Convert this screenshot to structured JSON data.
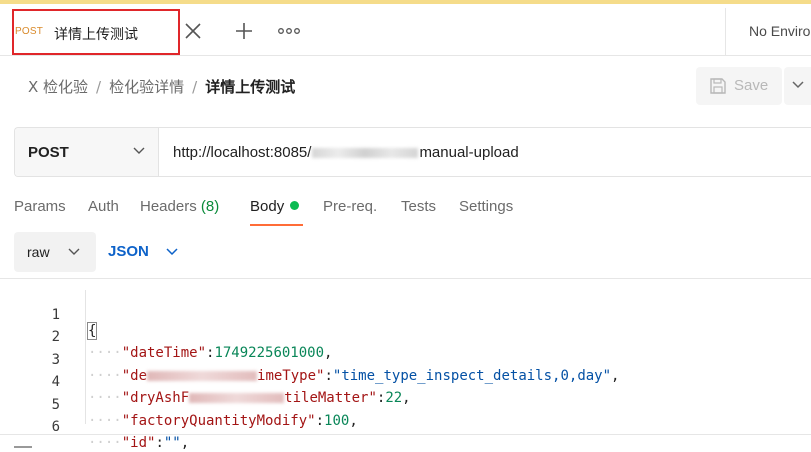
{
  "tab": {
    "method": "POST",
    "title": "详情上传测试"
  },
  "environment": {
    "label": "No Enviro"
  },
  "breadcrumb": {
    "items": [
      "X 检化验",
      "检化验详情"
    ],
    "separator": "/",
    "current": "详情上传测试"
  },
  "save": {
    "label": "Save"
  },
  "request": {
    "method": "POST",
    "url_prefix": "http://localhost:8085/",
    "url_suffix": "manual-upload"
  },
  "request_tabs": [
    {
      "label": "Params"
    },
    {
      "label": "Auth"
    },
    {
      "label": "Headers",
      "count": "(8)"
    },
    {
      "label": "Body"
    },
    {
      "label": "Pre-req."
    },
    {
      "label": "Tests"
    },
    {
      "label": "Settings"
    }
  ],
  "body": {
    "mode": "raw",
    "language": "JSON"
  },
  "editor": {
    "line_numbers": [
      "1",
      "2",
      "3",
      "4",
      "5",
      "6"
    ],
    "open_brace": "{",
    "l2": {
      "key": "\"dateTime\"",
      "value": "1749225601000"
    },
    "l3": {
      "key_start": "\"de",
      "key_end": "imeType\"",
      "value": "\"time_type_inspect_details,0,day\""
    },
    "l4": {
      "key_start": "\"dryAshF",
      "key_end": "tileMatter\"",
      "value": "22"
    },
    "l5": {
      "key": "\"factoryQuantityModify\"",
      "value": "100"
    },
    "l6": {
      "key": "\"id\"",
      "value": "\"\""
    }
  },
  "colors": {
    "accent": "#ff6c37",
    "active_dot": "#0cbb52",
    "tab_highlight": "#e0262a",
    "json_blue": "#0d62c9"
  }
}
